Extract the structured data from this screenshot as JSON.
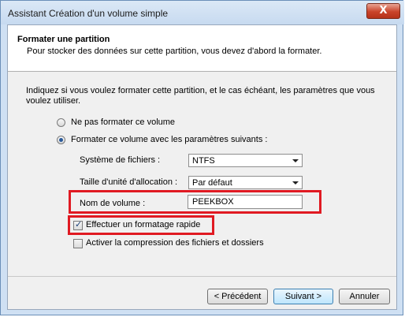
{
  "window": {
    "title": "Assistant Création d'un volume simple",
    "close_label": "X"
  },
  "header": {
    "title": "Formater une partition",
    "subtitle": "Pour stocker des données sur cette partition, vous devez d'abord la formater."
  },
  "intro": "Indiquez si vous voulez formater cette partition, et le cas échéant, les paramètres que vous voulez utiliser.",
  "options": {
    "no_format_label": "Ne pas formater ce volume",
    "format_label": "Formater ce volume avec les paramètres suivants :",
    "selected": "format"
  },
  "fields": {
    "filesystem_label": "Système de fichiers :",
    "filesystem_value": "NTFS",
    "allocation_label": "Taille d'unité d'allocation :",
    "allocation_value": "Par défaut",
    "volume_label": "Nom de volume :",
    "volume_value": "PEEKBOX"
  },
  "checkboxes": {
    "quick_format_label": "Effectuer un formatage rapide",
    "quick_format_checked": true,
    "compression_label": "Activer la compression des fichiers et dossiers",
    "compression_checked": false
  },
  "buttons": {
    "back": "< Précédent",
    "next": "Suivant >",
    "cancel": "Annuler"
  },
  "colors": {
    "highlight": "#e01a22",
    "close_button": "#c9432a"
  }
}
